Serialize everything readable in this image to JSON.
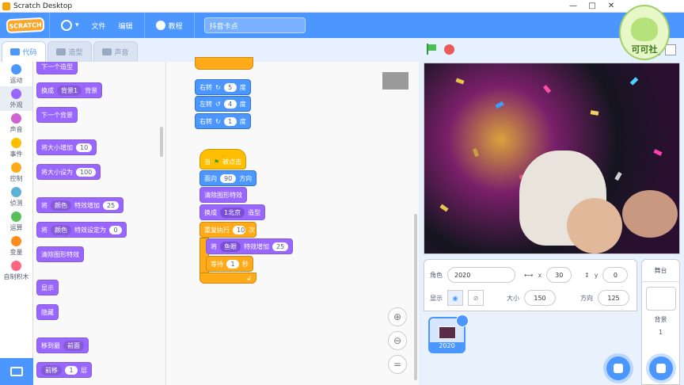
{
  "window": {
    "title": "Scratch Desktop",
    "controls": [
      "—",
      "□",
      "✕"
    ]
  },
  "menu": {
    "logo": "SCRATCH",
    "file": "文件",
    "edit": "编辑",
    "tutorials": "教程",
    "project_title": "抖音卡点"
  },
  "watermark": {
    "text": "可可社"
  },
  "tabs": {
    "code": "代码",
    "costumes": "造型",
    "sounds": "声音"
  },
  "categories": [
    {
      "label": "运动",
      "color": "#4c97ff"
    },
    {
      "label": "外观",
      "color": "#9966ff"
    },
    {
      "label": "声音",
      "color": "#cf63cf"
    },
    {
      "label": "事件",
      "color": "#ffbf00"
    },
    {
      "label": "控制",
      "color": "#ffab19"
    },
    {
      "label": "侦测",
      "color": "#5cb1d6"
    },
    {
      "label": "运算",
      "color": "#59c059"
    },
    {
      "label": "变量",
      "color": "#ff8c1a"
    },
    {
      "label": "自制积木",
      "color": "#ff6680"
    }
  ],
  "palette": {
    "next_costume": "下一个造型",
    "switch_bg": "换成",
    "switch_bg_value": "背景1",
    "switch_bg_suffix": "背景",
    "next_bg": "下一个背景",
    "change_size": "将大小增加",
    "change_size_value": "10",
    "set_size": "将大小设为",
    "set_size_value": "100",
    "change_effect_pre": "将",
    "effect_dropdown": "颜色",
    "change_effect_mid": "特效增加",
    "change_effect_value": "25",
    "set_effect_mid": "特效设定为",
    "set_effect_value": "0",
    "clear_effects": "清除图形特效",
    "show": "显示",
    "hide": "隐藏",
    "go_to_layer": "移到最",
    "layer_dropdown": "前面",
    "go_layers_dropdown": "前移",
    "go_layers_value": "1",
    "go_layers_suffix": "层"
  },
  "script": {
    "turn_right_1": "右转",
    "turn_right_1_value": "5",
    "turn_left": "左转",
    "turn_left_value": "4",
    "turn_right_2": "右转",
    "turn_right_2_value": "1",
    "degree": "度",
    "when_flag_pre": "当",
    "when_flag_post": "被点击",
    "point_dir": "面向",
    "point_dir_value": "90",
    "point_dir_suffix": "方向",
    "clear_effects": "清除图形特效",
    "switch_costume": "换成",
    "switch_costume_value": "1北京",
    "switch_costume_suffix": "造型",
    "repeat": "重复执行",
    "repeat_value": "10",
    "repeat_suffix": "次",
    "effect_pre": "将",
    "effect_dropdown": "鱼眼",
    "effect_mid": "特效增加",
    "effect_value": "25",
    "wait": "等待",
    "wait_value": "1",
    "wait_suffix": "秒"
  },
  "sprite_info": {
    "sprite_label": "角色",
    "sprite_name": "2020",
    "x_label": "x",
    "x_value": "30",
    "y_label": "y",
    "y_value": "0",
    "show_label": "显示",
    "size_label": "大小",
    "size_value": "150",
    "direction_label": "方向",
    "direction_value": "125"
  },
  "sprites": [
    {
      "name": "2020"
    }
  ],
  "stage_pane": {
    "title": "舞台",
    "backdrops_label": "背景",
    "backdrops_count": "1"
  }
}
